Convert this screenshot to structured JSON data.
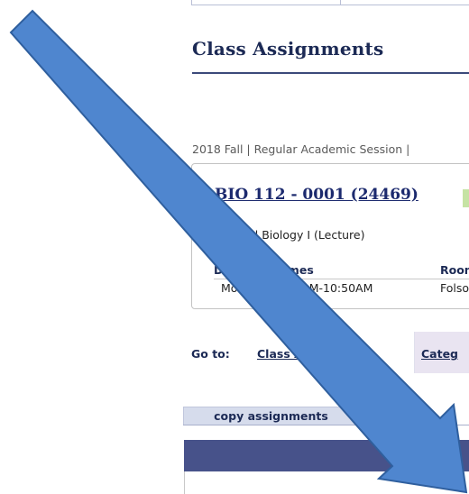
{
  "page": {
    "title": "Class Assignments",
    "term_info": "2018 Fall | Regular Academic Session |"
  },
  "class_section": {
    "course_link": "BIO 112 - 0001 (24469)",
    "description": "General Biology I (Lecture)",
    "schedule_headers": [
      "Days and Times",
      "Room"
    ],
    "schedule_rows": [
      {
        "days_times": "MoWeFr 10:00AM-10:50AM",
        "room": "Folso"
      }
    ]
  },
  "navigation": {
    "goto_label": "Go to:",
    "tabs": [
      "Class Assignments",
      "Categ"
    ]
  },
  "toolbar": {
    "copy_tab_label": "copy assignments"
  },
  "colors": {
    "title": "#1c2a55",
    "grid_header": "#47528a",
    "expand_triangle": "#2e9b3e",
    "arrow_fill": "#4f86cf",
    "arrow_stroke": "#2f5f9e"
  }
}
